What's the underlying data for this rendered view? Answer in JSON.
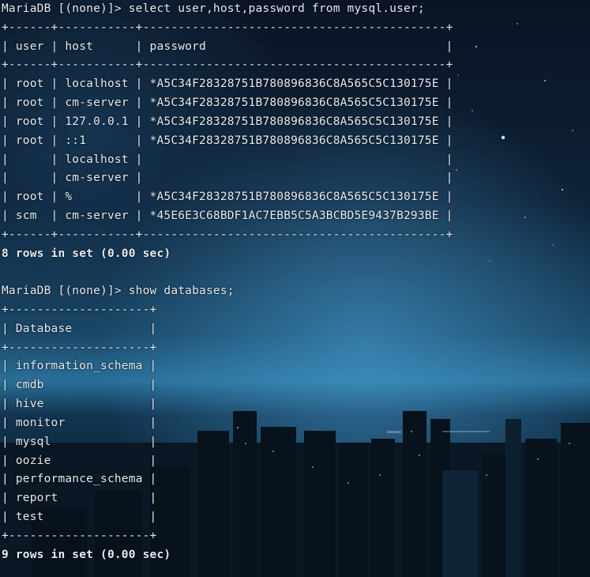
{
  "terminal": {
    "lines": [
      "MariaDB [(none)]> select user,host,password from mysql.user;",
      "+------+-----------+-------------------------------------------+",
      "| user | host      | password                                  |",
      "+------+-----------+-------------------------------------------+",
      "| root | localhost | *A5C34F28328751B780896836C8A565C5C130175E |",
      "| root | cm-server | *A5C34F28328751B780896836C8A565C5C130175E |",
      "| root | 127.0.0.1 | *A5C34F28328751B780896836C8A565C5C130175E |",
      "| root | ::1       | *A5C34F28328751B780896836C8A565C5C130175E |",
      "|      | localhost |                                           |",
      "|      | cm-server |                                           |",
      "| root | %         | *A5C34F28328751B780896836C8A565C5C130175E |",
      "| scm  | cm-server | *45E6E3C68BDF1AC7EBB5C5A3BCBD5E9437B293BE |",
      "+------+-----------+-------------------------------------------+",
      "8 rows in set (0.00 sec)",
      "",
      "MariaDB [(none)]> show databases;",
      "+--------------------+",
      "| Database           |",
      "+--------------------+",
      "| information_schema |",
      "| cmdb               |",
      "| hive               |",
      "| monitor            |",
      "| mysql              |",
      "| oozie              |",
      "| performance_schema |",
      "| report             |",
      "| test               |",
      "+--------------------+",
      "9 rows in set (0.00 sec)"
    ],
    "bold_lines": [
      13,
      29
    ],
    "text_color": "#e6ecf2"
  },
  "colors": {
    "sky_top": "#0b1628",
    "sky_mid": "#113048",
    "haze": "#2a6f98",
    "city_dark": "#07121c",
    "city_light": "#6fb3e0"
  }
}
